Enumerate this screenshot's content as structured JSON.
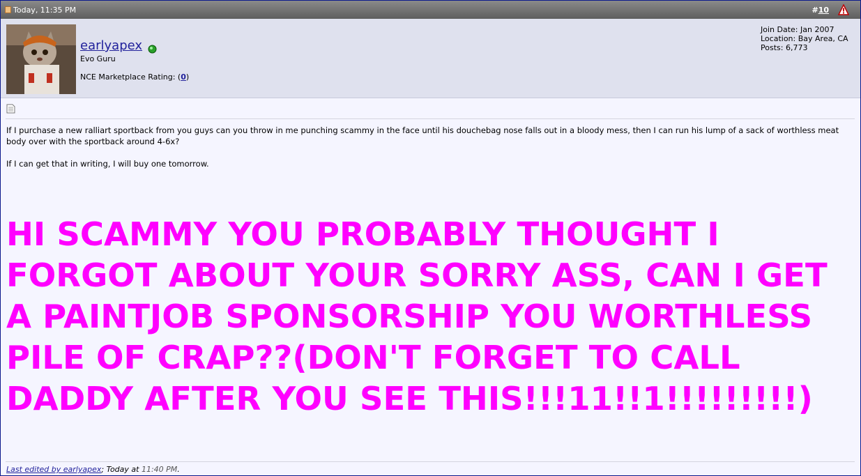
{
  "titlebar": {
    "date": "Today, 11:35 PM",
    "post_prefix": "#",
    "post_number": "10"
  },
  "user": {
    "name": "earlyapex",
    "title": "Evo Guru",
    "rating_label": "NCE Marketplace Rating: (",
    "rating_value": "0",
    "rating_suffix": ")",
    "join_date": "Join Date: Jan 2007",
    "location": "Location: Bay Area, CA",
    "posts": "Posts: 6,773"
  },
  "message": {
    "para1": "If I purchase a new ralliart sportback from you guys can you throw in me punching scammy in the face until his douchebag nose falls out in a bloody mess, then I can run his lump of a sack of worthless meat body over with the sportback around 4-6x?",
    "para2": "If I can get that in writing, I will buy one tomorrow.",
    "shout": "HI SCAMMY YOU PROBABLY THOUGHT I FORGOT ABOUT YOUR SORRY ASS, CAN I GET A PAINTJOB SPONSORSHIP YOU WORTHLESS PILE OF CRAP??(DON'T FORGET TO CALL DADDY AFTER YOU SEE THIS!!!11!!1!!!!!!!!!)"
  },
  "footer": {
    "edited_link": "Last edited by earlyapex",
    "separator": "; Today at ",
    "time": "11:40 PM",
    "end": "."
  },
  "colors": {
    "shout": "#ff00ff",
    "link": "#22229c",
    "titlebar": "#6e6e6e",
    "userbar": "#dfe1ee",
    "body": "#f5f5ff"
  },
  "icons": [
    "post-icon",
    "report-icon",
    "online-status-icon",
    "document-icon"
  ]
}
